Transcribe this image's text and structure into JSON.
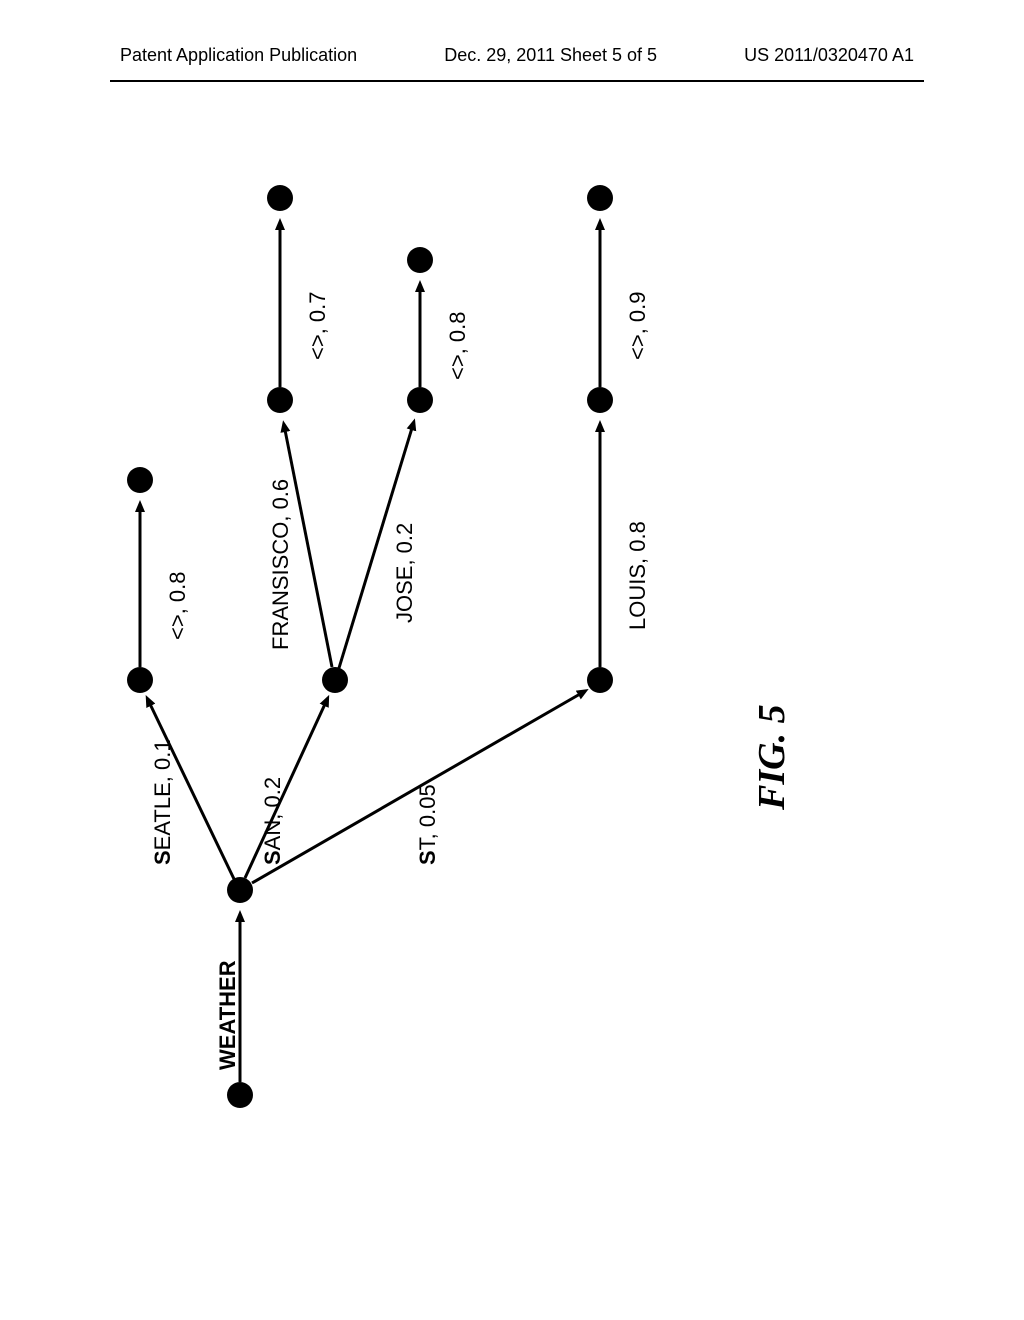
{
  "header": {
    "left": "Patent Application Publication",
    "center": "Dec. 29, 2011  Sheet 5 of 5",
    "right": "US 2011/0320470 A1"
  },
  "figure_label": "FIG. 5",
  "edges": {
    "weather": {
      "label": "WEATHER",
      "bold_weather": true
    },
    "seatle": {
      "prefix": "S",
      "rest": "EATLE, 0.1"
    },
    "san": {
      "prefix": "S",
      "rest": "AN, 0.2"
    },
    "st": {
      "prefix": "S",
      "rest": "T, 0.05"
    },
    "fransisco": {
      "label": "FRANSISCO, 0.6"
    },
    "jose": {
      "label": "JOSE, 0.2"
    },
    "louis": {
      "label": "LOUIS, 0.8"
    },
    "end1": {
      "label": "<>, 0.8"
    },
    "end2": {
      "label": "<>, 0.7"
    },
    "end3": {
      "label": "<>, 0.8"
    },
    "end4": {
      "label": "<>, 0.9"
    }
  }
}
